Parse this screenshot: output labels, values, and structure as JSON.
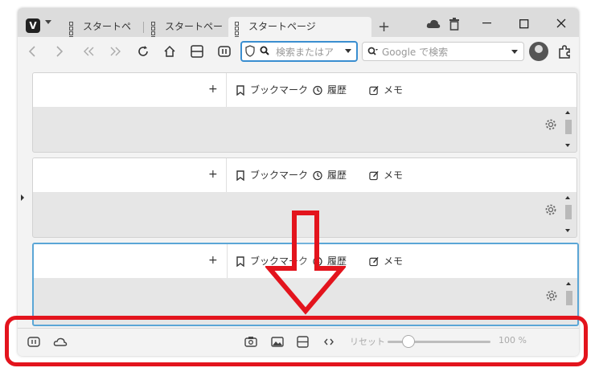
{
  "tabs": [
    {
      "label": "スタートページ"
    },
    {
      "label": "スタートページ"
    },
    {
      "label": "スタートページ"
    }
  ],
  "navbar": {
    "address_placeholder": "検索またはア",
    "search_placeholder": "Google で検索"
  },
  "panel": {
    "add_label": "+",
    "bookmarks_label": "ブックマーク",
    "history_label": "履歴",
    "notes_label": "メモ"
  },
  "statusbar": {
    "reset_label": "リセット",
    "zoom_value": "100 %"
  },
  "colors": {
    "focus_border": "#5ba6d6",
    "address_border": "#3a8ed0",
    "annotation_red": "#e3141d"
  }
}
